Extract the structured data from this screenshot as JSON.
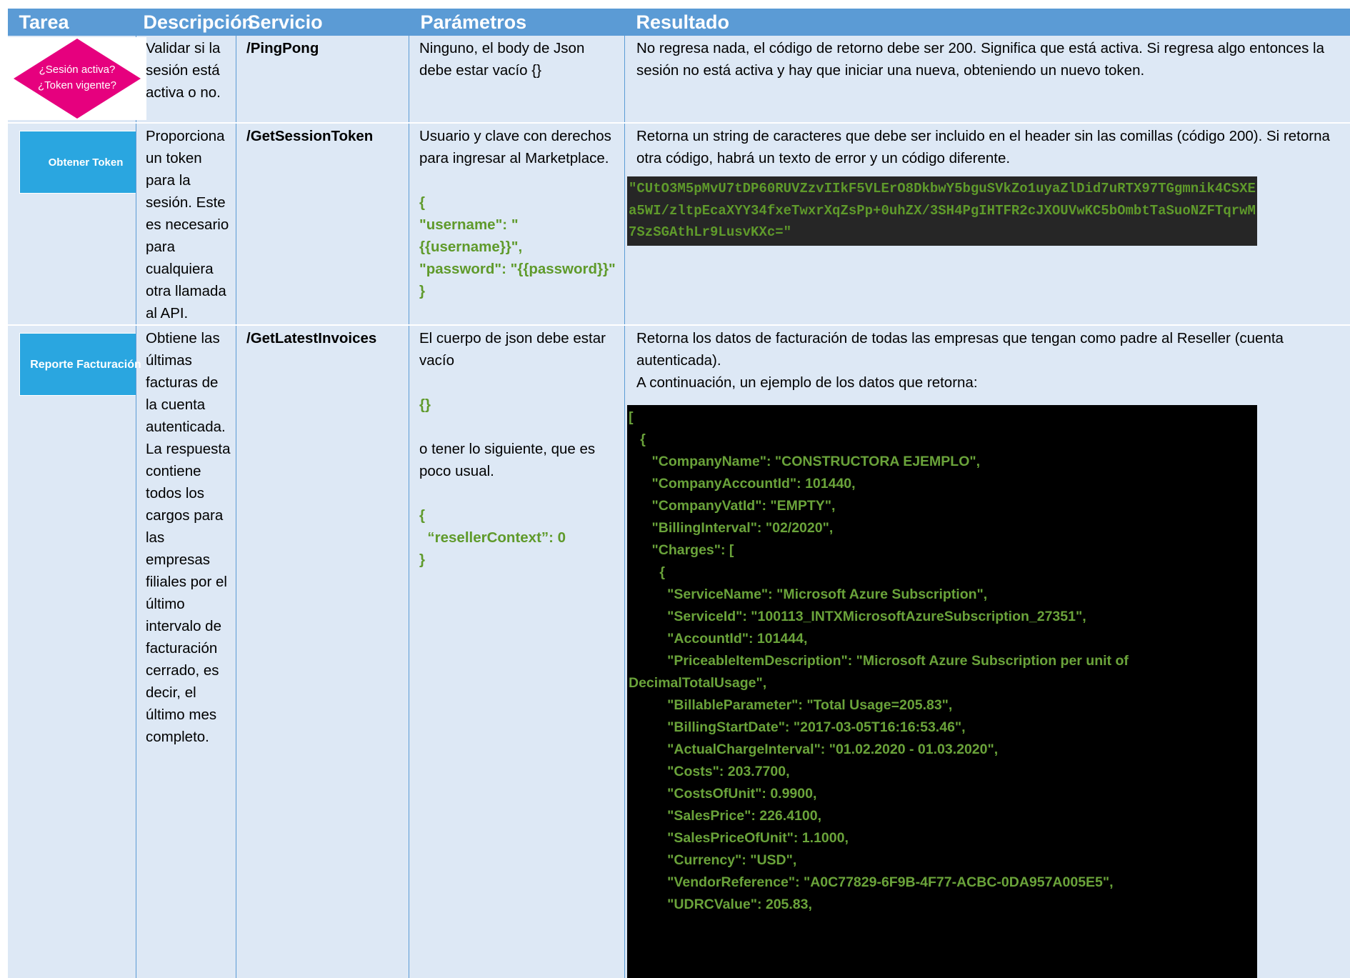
{
  "headers": {
    "tarea": "Tarea",
    "descripcion": "Descripción",
    "servicio": "Servicio",
    "parametros": "Parámetros",
    "resultado": "Resultado"
  },
  "rows": [
    {
      "task_graphic": {
        "type": "diamond",
        "line1": "¿Sesión activa?",
        "line2": "¿Token vigente?",
        "color": "#e6007e"
      },
      "descripcion": "Validar si la sesión está activa o no.",
      "servicio": "/PingPong",
      "parametros": "Ninguno, el body de Json debe estar vacío {}",
      "resultado": "No regresa nada, el código de retorno debe ser 200. Significa que está activa. Si regresa algo entonces la sesión no está activa y hay que iniciar una nueva, obteniendo un nuevo token."
    },
    {
      "task_graphic": {
        "type": "box",
        "label": "Obtener Token",
        "color": "#2aa6e0"
      },
      "descripcion": "Proporciona un token para la sesión. Este es necesario para cualquiera otra llamada al API.",
      "servicio": "/GetSessionToken",
      "parametros": "Usuario y clave con derechos para ingresar al Marketplace.",
      "parametros_code": [
        "{",
        "\"username\": \"{{username}}\",",
        "\"password\": \"{{password}}\"",
        "}"
      ],
      "resultado": "Retorna un string de caracteres que debe ser incluido en el header sin las comillas (código 200). Si retorna otra código, habrá un texto de error y un código diferente.",
      "token": "\"CUtO3M5pMvU7tDP60RUVZzvIIkF5VLErO8DkbwY5bguSVkZo1uyaZlDid7uRTX97TGgmnik4CSXEa5WI/zltpEcaXYY34fxeTwxrXqZsPp+0uhZX/3SH4PgIHTFR2cJXOUVwKC5bOmbtTaSuoNZFTqrwM7SzSGAthLr9LusvKXc=\""
    },
    {
      "task_graphic": {
        "type": "box",
        "label": "Reporte Facturación",
        "color": "#2aa6e0"
      },
      "descripcion": "Obtiene las últimas facturas de la cuenta autenticada. La respuesta contiene todos los cargos para las empresas filiales por el último intervalo de facturación cerrado, es decir, el último mes completo.",
      "servicio": "/GetLatestInvoices",
      "parametros": "El cuerpo de json debe estar vacío",
      "parametros_code1": "{}",
      "parametros2": "o tener lo siguiente, que es poco usual.",
      "parametros_code2": [
        "{",
        "  “resellerContext”: 0",
        "}"
      ],
      "resultado": "Retorna los datos de facturación de todas las empresas que tengan como padre al Reseller (cuenta autenticada).",
      "resultado2": "A continuación, un ejemplo de los datos que retorna:",
      "json_lines": [
        "[",
        "   {",
        "      \"CompanyName\": \"CONSTRUCTORA EJEMPLO\",",
        "      \"CompanyAccountId\": 101440,",
        "      \"CompanyVatId\": \"EMPTY\",",
        "      \"BillingInterval\": \"02/2020\",",
        "      \"Charges\": [",
        "        {",
        "          \"ServiceName\": \"Microsoft Azure Subscription\",",
        "          \"ServiceId\": \"100113_INTXMicrosoftAzureSubscription_27351\",",
        "          \"AccountId\": 101444,",
        "          \"PriceableItemDescription\": \"Microsoft Azure Subscription per unit of",
        "DecimalTotalUsage\",",
        "          \"BillableParameter\": \"Total Usage=205.83\",",
        "          \"BillingStartDate\": \"2017-03-05T16:16:53.46\",",
        "          \"ActualChargeInterval\": \"01.02.2020 - 01.03.2020\",",
        "          \"Costs\": 203.7700,",
        "          \"CostsOfUnit\": 0.9900,",
        "          \"SalesPrice\": 226.4100,",
        "          \"SalesPriceOfUnit\": 1.1000,",
        "          \"Currency\": \"USD\",",
        "          \"VendorReference\": \"A0C77829-6F9B-4F77-ACBC-0DA957A005E5\",",
        "          \"UDRCValue\": 205.83,"
      ]
    }
  ]
}
